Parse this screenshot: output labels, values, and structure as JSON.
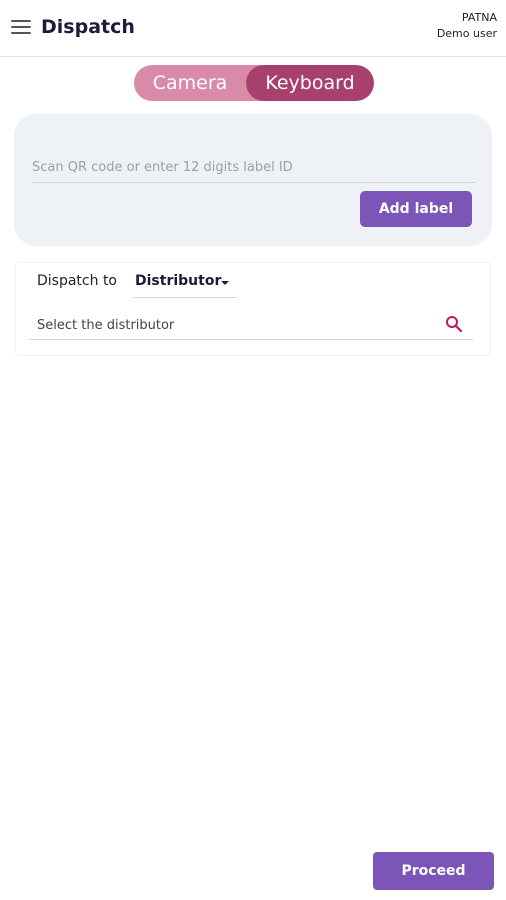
{
  "header": {
    "title": "Dispatch",
    "location": "PATNA",
    "user": "Demo user"
  },
  "mode_toggle": {
    "camera_label": "Camera",
    "keyboard_label": "Keyboard",
    "selected": "Keyboard"
  },
  "scan": {
    "placeholder": "Scan QR code or enter 12 digits label ID",
    "value": "",
    "add_label_button": "Add label"
  },
  "dispatch": {
    "dispatch_to_label": "Dispatch to",
    "selected_type": "Distributor",
    "search_placeholder": "Select the distributor"
  },
  "footer": {
    "proceed_button": "Proceed"
  },
  "colors": {
    "accent_purple": "#7b55b8",
    "toggle_active": "#a8406d",
    "toggle_inactive": "#d98aa8",
    "scan_card_bg": "#eef1f6",
    "search_icon": "#c2185b"
  }
}
